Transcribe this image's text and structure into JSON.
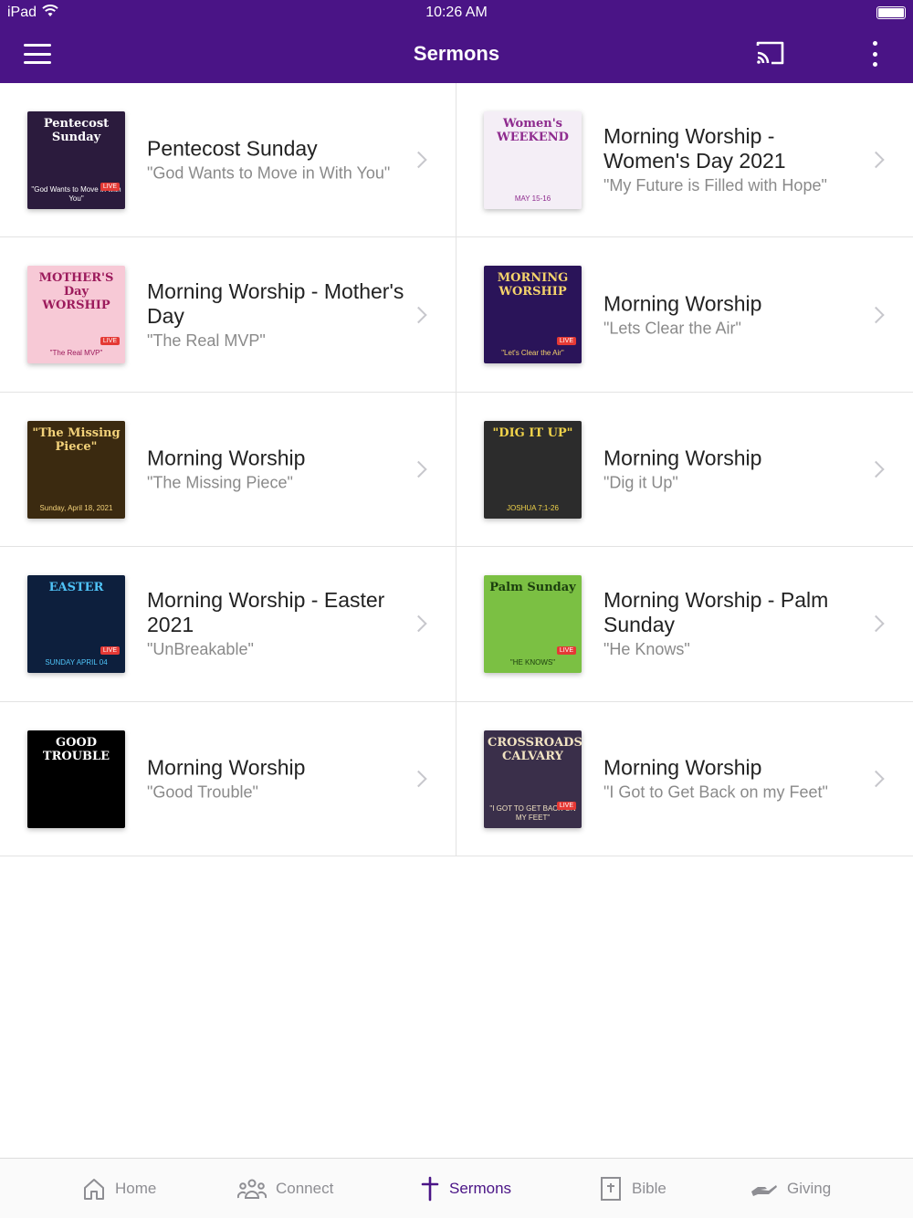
{
  "status": {
    "device": "iPad",
    "time": "10:26 AM"
  },
  "app_bar": {
    "title": "Sermons",
    "menu_icon": "hamburger-menu-icon",
    "cast_icon": "cast-icon",
    "more_icon": "more-vert-icon"
  },
  "sermons": [
    {
      "title": "Pentecost Sunday",
      "subtitle": "\"God Wants to Move in With You\"",
      "thumb_caption": "Pentecost Sunday",
      "thumb_sub": "\"God Wants to Move in with You\"",
      "thumb_bg": "#2b1b3d",
      "thumb_fg": "#ffffff",
      "thumb_live": "LIVE"
    },
    {
      "title": "Morning Worship - Women's Day 2021",
      "subtitle": "\"My Future is Filled with Hope\"",
      "thumb_caption": "Women's WEEKEND",
      "thumb_sub": "MAY 15-16",
      "thumb_bg": "#f4eef6",
      "thumb_fg": "#8e2b8e",
      "thumb_live": ""
    },
    {
      "title": "Morning Worship - Mother's Day",
      "subtitle": "\"The Real MVP\"",
      "thumb_caption": "MOTHER'S Day WORSHIP",
      "thumb_sub": "\"The Real MVP\"",
      "thumb_bg": "#f7c9d6",
      "thumb_fg": "#9c1b5c",
      "thumb_live": "LIVE"
    },
    {
      "title": "Morning Worship",
      "subtitle": "\"Lets Clear the Air\"",
      "thumb_caption": "MORNING WORSHIP",
      "thumb_sub": "\"Let's Clear the Air\"",
      "thumb_bg": "#2a1459",
      "thumb_fg": "#f5d36b",
      "thumb_live": "LIVE"
    },
    {
      "title": "Morning Worship",
      "subtitle": "\"The Missing Piece\"",
      "thumb_caption": "\"The Missing Piece\"",
      "thumb_sub": "Sunday, April 18, 2021",
      "thumb_bg": "#3b2a10",
      "thumb_fg": "#f3d27a",
      "thumb_live": ""
    },
    {
      "title": "Morning Worship",
      "subtitle": "\"Dig it Up\"",
      "thumb_caption": "\"DIG IT UP\"",
      "thumb_sub": "JOSHUA 7:1-26",
      "thumb_bg": "#2c2c2c",
      "thumb_fg": "#f0d34a",
      "thumb_live": ""
    },
    {
      "title": "Morning Worship - Easter 2021",
      "subtitle": "\"UnBreakable\"",
      "thumb_caption": "EASTER",
      "thumb_sub": "SUNDAY APRIL 04",
      "thumb_bg": "#0d1f3d",
      "thumb_fg": "#4fc3f7",
      "thumb_live": "LIVE"
    },
    {
      "title": "Morning Worship - Palm Sunday",
      "subtitle": "\"He Knows\"",
      "thumb_caption": "Palm Sunday",
      "thumb_sub": "\"HE KNOWS\"",
      "thumb_bg": "#7bc043",
      "thumb_fg": "#1b3d0e",
      "thumb_live": "LIVE"
    },
    {
      "title": "Morning Worship",
      "subtitle": "\"Good Trouble\"",
      "thumb_caption": "GOOD TROUBLE",
      "thumb_sub": "",
      "thumb_bg": "#000000",
      "thumb_fg": "#ffffff",
      "thumb_live": ""
    },
    {
      "title": "Morning Worship",
      "subtitle": "\"I Got to Get Back on my Feet\"",
      "thumb_caption": "CROSSROADS CALVARY",
      "thumb_sub": "\"I GOT TO GET BACK ON MY FEET\"",
      "thumb_bg": "#3a2f4a",
      "thumb_fg": "#f1e3c2",
      "thumb_live": "LIVE"
    }
  ],
  "tabs": [
    {
      "label": "Home",
      "icon": "home-icon",
      "active": false
    },
    {
      "label": "Connect",
      "icon": "people-icon",
      "active": false
    },
    {
      "label": "Sermons",
      "icon": "cross-icon",
      "active": true
    },
    {
      "label": "Bible",
      "icon": "bible-icon",
      "active": false
    },
    {
      "label": "Giving",
      "icon": "giving-hand-icon",
      "active": false
    }
  ],
  "colors": {
    "brand": "#4a1486",
    "inactive_tab": "#8e8e93",
    "subtitle": "#8a8a8a"
  }
}
